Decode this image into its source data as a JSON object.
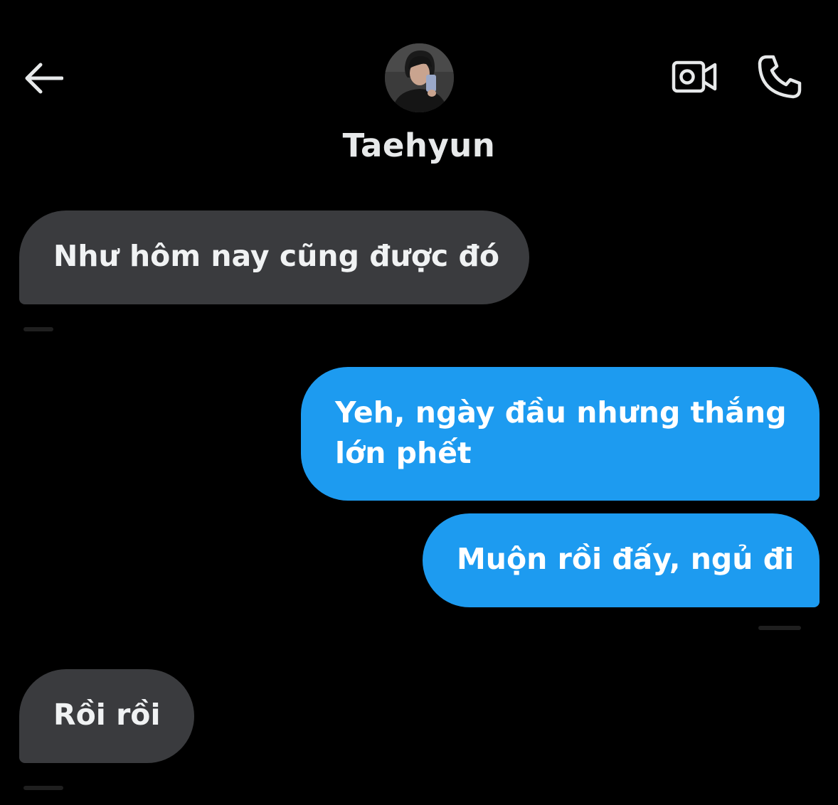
{
  "header": {
    "back_icon": "arrow-left-icon",
    "contact_name": "Taehyun",
    "video_call_icon": "video-camera-icon",
    "voice_call_icon": "phone-icon"
  },
  "colors": {
    "background": "#000000",
    "received_bubble": "#3a3b3e",
    "sent_bubble": "#1d9bf0",
    "text": "#e7e9ea"
  },
  "messages": [
    {
      "direction": "received",
      "text": "Như hôm nay cũng được đó"
    },
    {
      "direction": "sent",
      "text": "Yeh, ngày đầu nhưng thắng lớn phết"
    },
    {
      "direction": "sent",
      "text": "Muộn rồi đấy, ngủ đi"
    },
    {
      "direction": "received",
      "text": "Rồi rồi"
    }
  ]
}
